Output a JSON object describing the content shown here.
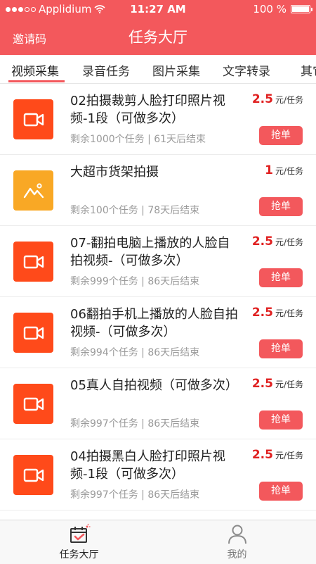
{
  "status_bar": {
    "carrier": "Applidium",
    "time": "11:27 AM",
    "battery": "100 %"
  },
  "nav": {
    "invite_label": "邀请码",
    "title": "任务大厅"
  },
  "tabs": [
    {
      "label": "视频采集",
      "active": true
    },
    {
      "label": "录音任务",
      "active": false
    },
    {
      "label": "图片采集",
      "active": false
    },
    {
      "label": "文字转录",
      "active": false
    },
    {
      "label": "其它",
      "active": false
    }
  ],
  "tasks": [
    {
      "icon": "video-camera-icon",
      "title": "02拍摄裁剪人脸打印照片视频-1段（可做多次）",
      "price": "2.5",
      "unit": "元/任务",
      "remaining": "剩余1000个任务 | 61天后结束",
      "button": "抢单"
    },
    {
      "icon": "mountain-photo-icon",
      "title": "大超市货架拍摄",
      "price": "1",
      "unit": "元/任务",
      "remaining": "剩余100个任务 | 78天后结束",
      "button": "抢单"
    },
    {
      "icon": "video-camera-icon",
      "title": "07-翻拍电脑上播放的人脸自拍视频-（可做多次）",
      "price": "2.5",
      "unit": "元/任务",
      "remaining": "剩余999个任务 | 86天后结束",
      "button": "抢单"
    },
    {
      "icon": "video-camera-icon",
      "title": "06翻拍手机上播放的人脸自拍视频-（可做多次）",
      "price": "2.5",
      "unit": "元/任务",
      "remaining": "剩余994个任务 | 86天后结束",
      "button": "抢单"
    },
    {
      "icon": "video-camera-icon",
      "title": "05真人自拍视频（可做多次）",
      "price": "2.5",
      "unit": "元/任务",
      "remaining": "剩余997个任务 | 86天后结束",
      "button": "抢单"
    },
    {
      "icon": "video-camera-icon",
      "title": "04拍摄黑白人脸打印照片视频-1段（可做多次）",
      "price": "2.5",
      "unit": "元/任务",
      "remaining": "剩余997个任务 | 86天后结束",
      "button": "抢单"
    }
  ],
  "bottom_tabs": [
    {
      "label": "任务大厅",
      "icon": "task-calendar-icon",
      "active": true
    },
    {
      "label": "我的",
      "icon": "user-profile-icon",
      "active": false
    }
  ],
  "colors": {
    "brand": "#f3585c",
    "price": "#e02020",
    "video_icon_bg": "#ff4a1a",
    "photo_icon_bg": "#f9a825"
  }
}
